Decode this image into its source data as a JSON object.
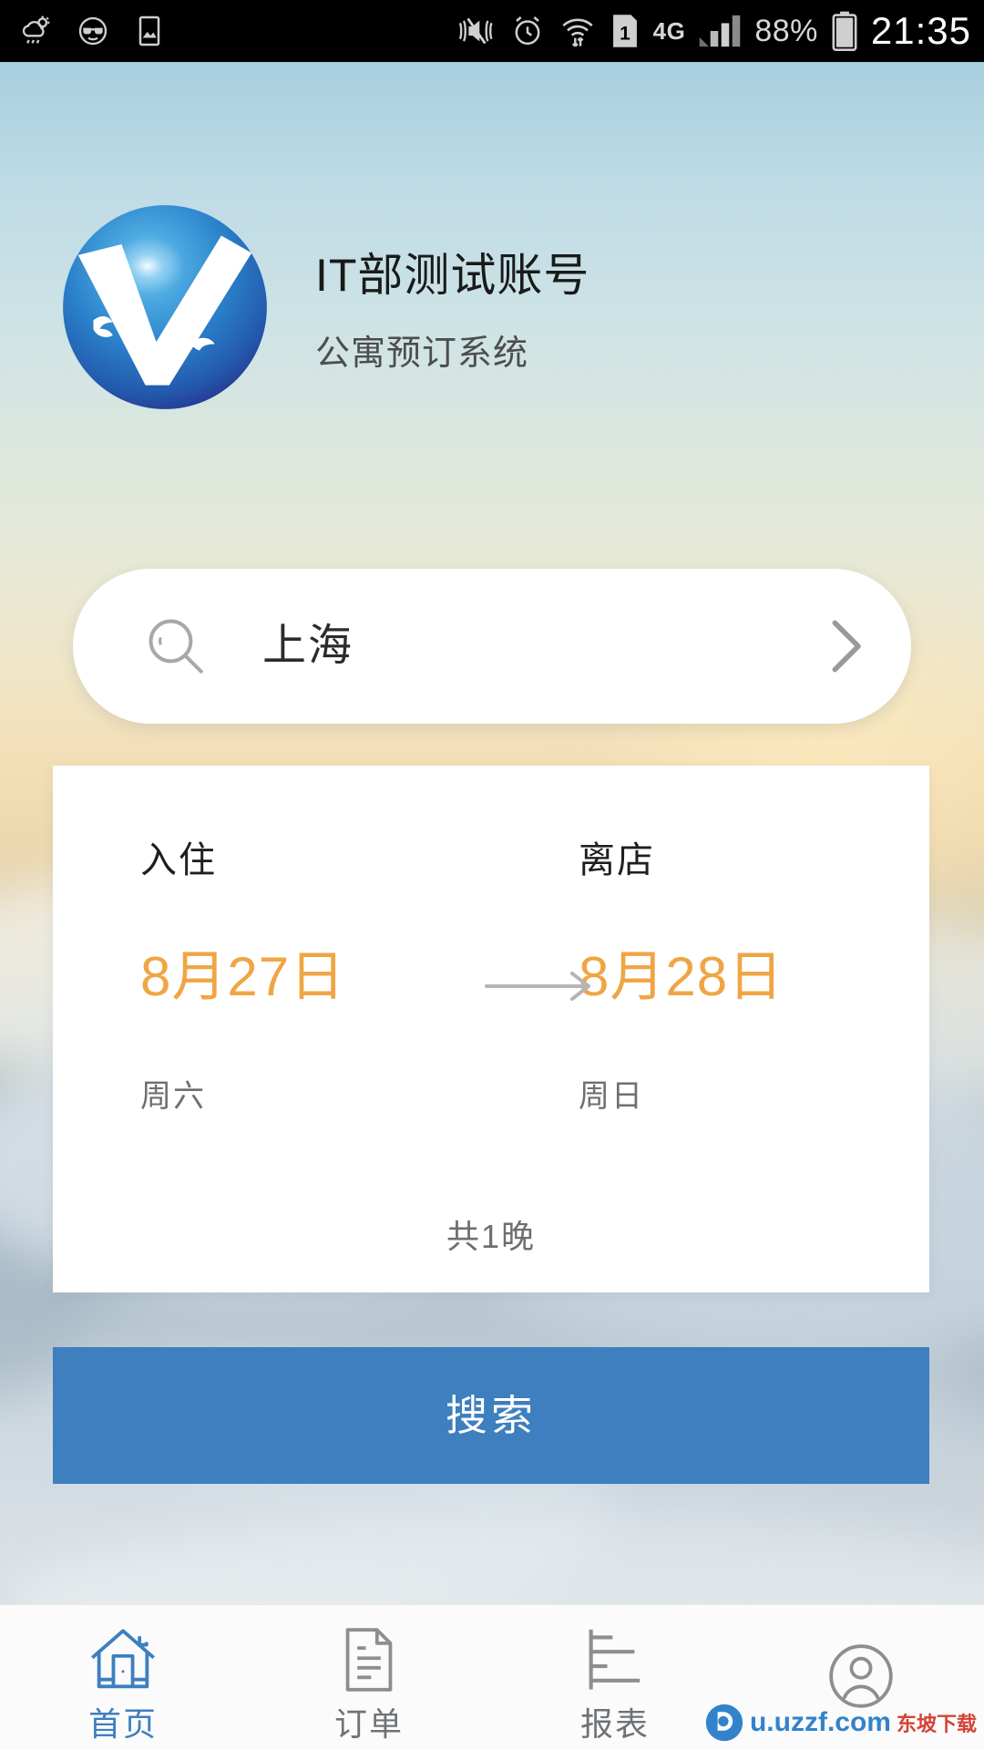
{
  "statusbar": {
    "battery_percent": "88%",
    "network": "4G",
    "clock": "21:35",
    "left_icons": [
      "weather-rain-sun-icon",
      "smiley-sunglasses-icon",
      "gallery-photo-icon"
    ],
    "right_icons": [
      "mute-vibrate-icon",
      "alarm-clock-icon",
      "wifi-icon",
      "sim1-icon",
      "signal-bars-icon",
      "battery-icon"
    ]
  },
  "header": {
    "title": "IT部测试账号",
    "subtitle": "公寓预订系统",
    "logo_name": "blue-globe-seagull-logo"
  },
  "search": {
    "icon": "search-icon",
    "value": "上海",
    "placeholder": "上海",
    "chevron": "chevron-right-icon"
  },
  "dates": {
    "checkin_label": "入住",
    "checkout_label": "离店",
    "checkin_date": "8月27日",
    "checkout_date": "8月28日",
    "checkin_week": "周六",
    "checkout_week": "周日",
    "arrow": "arrow-right-icon",
    "nights": "共1晚"
  },
  "actions": {
    "search_label": "搜索"
  },
  "tabbar": {
    "items": [
      {
        "label": "首页",
        "icon": "home-icon",
        "active": true
      },
      {
        "label": "订单",
        "icon": "document-order-icon",
        "active": false
      },
      {
        "label": "报表",
        "icon": "bar-chart-report-icon",
        "active": false
      },
      {
        "label": "",
        "icon": "user-profile-icon",
        "active": false
      }
    ]
  },
  "watermark": {
    "text": "u.uzzf.com",
    "sub": "东坡下载"
  },
  "colors": {
    "accent_blue": "#3d7fbf",
    "date_orange": "#f0a544",
    "tab_inactive": "#6f7376"
  }
}
